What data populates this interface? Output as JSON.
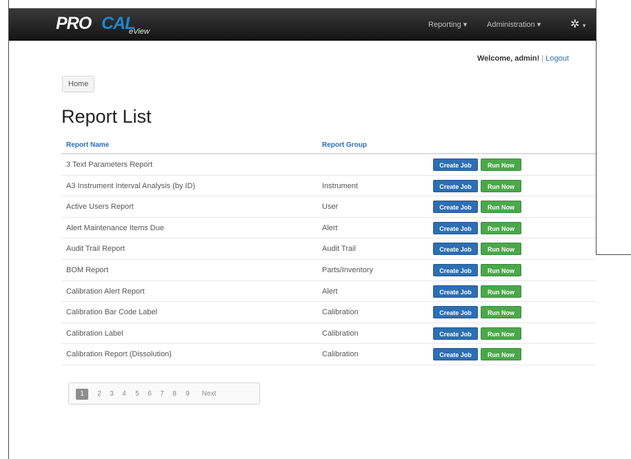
{
  "navbar": {
    "logo_pro": "PRO",
    "logo_cal": "CAL",
    "logo_eview": "eView",
    "reporting": "Reporting ▾",
    "administration": "Administration ▾",
    "gear_glyph": "✲",
    "gear_caret": "▾",
    "gear_icon": "gear-icon"
  },
  "welcome": {
    "text": "Welcome, admin!",
    "separator": "|",
    "logout": "Logout"
  },
  "breadcrumb": {
    "home": "Home"
  },
  "page_title": "Report List",
  "table": {
    "headers": {
      "name": "Report Name",
      "group": "Report Group"
    },
    "buttons": {
      "create": "Create Job",
      "run": "Run Now"
    },
    "rows": [
      {
        "name": "3 Text Parameters Report",
        "group": ""
      },
      {
        "name": "A3 Instrument Interval Analysis (by ID)",
        "group": "Instrument"
      },
      {
        "name": "Active Users Report",
        "group": "User"
      },
      {
        "name": "Alert Maintenance Items Due",
        "group": "Alert"
      },
      {
        "name": "Audit Trail Report",
        "group": "Audit Trail"
      },
      {
        "name": "BOM Report",
        "group": "Parts/Inventory"
      },
      {
        "name": "Calibration Alert Report",
        "group": "Alert"
      },
      {
        "name": "Calibration Bar Code Label",
        "group": "Calibration"
      },
      {
        "name": "Calibration Label",
        "group": "Calibration"
      },
      {
        "name": "Calibration Report (Dissolution)",
        "group": "Calibration"
      }
    ]
  },
  "pagination": {
    "pages": [
      "1",
      "2",
      "3",
      "4",
      "5",
      "6",
      "7",
      "8",
      "9"
    ],
    "active": "1",
    "next": "Next"
  },
  "colors": {
    "create_button": "#2d6fb3",
    "run_button": "#4aa84a",
    "link": "#2a6fb5",
    "navbar": "#1c1c1c"
  }
}
